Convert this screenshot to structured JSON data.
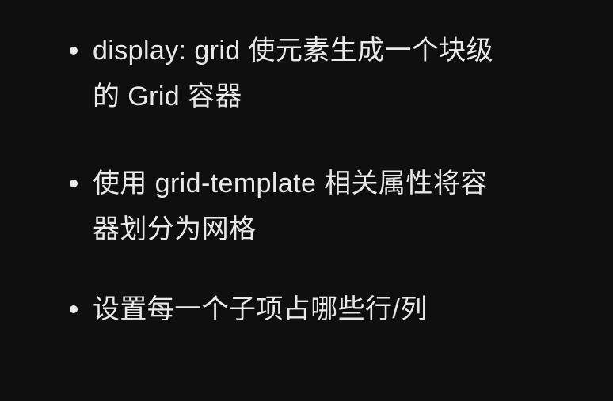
{
  "slide": {
    "bullets": [
      {
        "text": "display: grid 使元素生成一个块级\n的 Grid 容器"
      },
      {
        "text": "使用 grid-template 相关属性将容\n器划分为网格"
      },
      {
        "text": "设置每一个子项占哪些行/列"
      }
    ]
  },
  "colors": {
    "background": "#0f0f0f",
    "text": "#e9e9e9"
  }
}
